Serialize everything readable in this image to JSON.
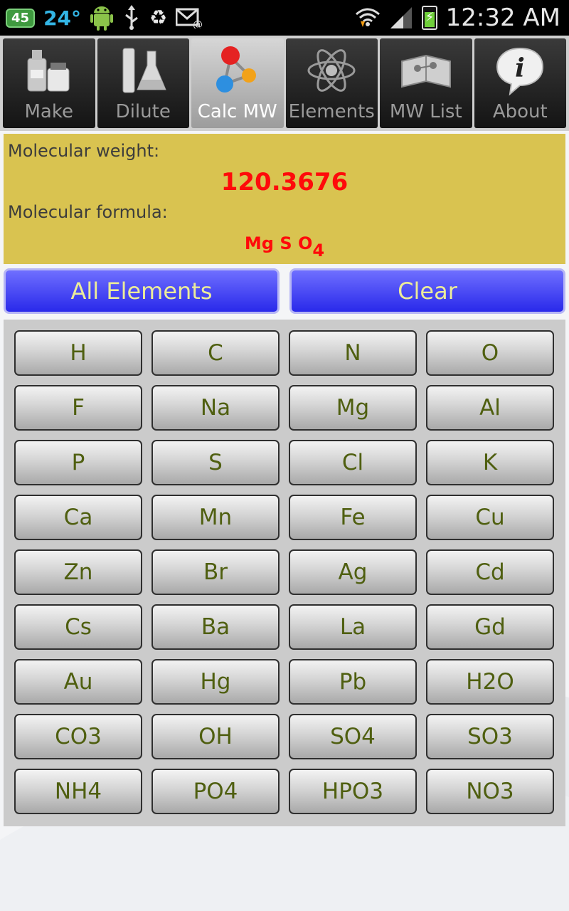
{
  "status_bar": {
    "notification_count": "45",
    "temperature": "24°",
    "time": "12:32 AM"
  },
  "tabs": [
    {
      "label": "Make",
      "icon": "bottles-icon",
      "selected": false
    },
    {
      "label": "Dilute",
      "icon": "flask-icon",
      "selected": false
    },
    {
      "label": "Calc MW",
      "icon": "molecule-icon",
      "selected": true
    },
    {
      "label": "Elements",
      "icon": "atom-icon",
      "selected": false
    },
    {
      "label": "MW List",
      "icon": "book-icon",
      "selected": false
    },
    {
      "label": "About",
      "icon": "info-icon",
      "selected": false
    }
  ],
  "result": {
    "mw_label": "Molecular weight:",
    "mw_value": "120.3676",
    "mf_label": "Molecular formula:",
    "mf_prefix": "Mg S O",
    "mf_subscript": "4"
  },
  "actions": {
    "all_elements": "All Elements",
    "clear": "Clear"
  },
  "elements": [
    "H",
    "C",
    "N",
    "O",
    "F",
    "Na",
    "Mg",
    "Al",
    "P",
    "S",
    "Cl",
    "K",
    "Ca",
    "Mn",
    "Fe",
    "Cu",
    "Zn",
    "Br",
    "Ag",
    "Cd",
    "Cs",
    "Ba",
    "La",
    "Gd",
    "Au",
    "Hg",
    "Pb",
    "H2O",
    "CO3",
    "OH",
    "SO4",
    "SO3",
    "NH4",
    "PO4",
    "HPO3",
    "NO3"
  ],
  "colors": {
    "result_bg": "#d9c350",
    "value_red": "#ff0a0a",
    "button_blue": "#3c3cf0",
    "element_text": "#4f5f10"
  }
}
